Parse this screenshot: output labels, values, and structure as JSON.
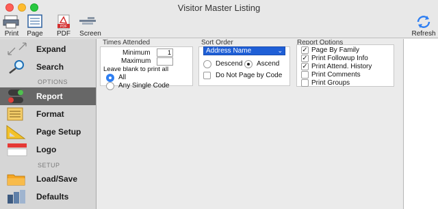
{
  "window": {
    "title": "Visitor Master Listing"
  },
  "toolbar": {
    "print": "Print",
    "page": "Page",
    "pdf": "PDF",
    "screen": "Screen",
    "refresh": "Refresh",
    "pdf_icon_text": "PDF"
  },
  "sidebar": {
    "items": [
      {
        "label": "Expand",
        "icon": "expand-icon"
      },
      {
        "label": "Search",
        "icon": "magnifier-icon"
      },
      {
        "label": "Report",
        "icon": "toggle-icon",
        "active": true
      },
      {
        "label": "Format",
        "icon": "format-icon"
      },
      {
        "label": "Page Setup",
        "icon": "page-setup-icon"
      },
      {
        "label": "Logo",
        "icon": "logo-icon"
      },
      {
        "label": "Load/Save",
        "icon": "folder-icon"
      },
      {
        "label": "Defaults",
        "icon": "defaults-icon"
      }
    ],
    "sections": {
      "options": "OPTIONS",
      "setup": "SETUP"
    }
  },
  "times_attended": {
    "title": "Times Attended",
    "minimum_label": "Minimum",
    "minimum_value": "1",
    "maximum_label": "Maximum",
    "maximum_value": "",
    "hint": "Leave blank to print all",
    "options": [
      "All",
      "Any Single Code"
    ],
    "selected": "All"
  },
  "sort_order": {
    "title": "Sort Order",
    "selected": "Address Name",
    "descend": "Descend",
    "ascend": "Ascend",
    "direction": "Ascend",
    "no_page_label": "Do Not Page by Code",
    "no_page_checked": false
  },
  "report_options": {
    "title": "Report Options",
    "items": [
      {
        "label": "Page By Family",
        "checked": true
      },
      {
        "label": "Print Followup Info",
        "checked": true
      },
      {
        "label": "Print Attend. History",
        "checked": true
      },
      {
        "label": "Print Comments",
        "checked": false
      },
      {
        "label": "Print Groups",
        "checked": false
      }
    ]
  },
  "colors": {
    "accent": "#2f7ff2",
    "active_sidebar": "#676767",
    "select_bg": "#1f5fd6"
  }
}
